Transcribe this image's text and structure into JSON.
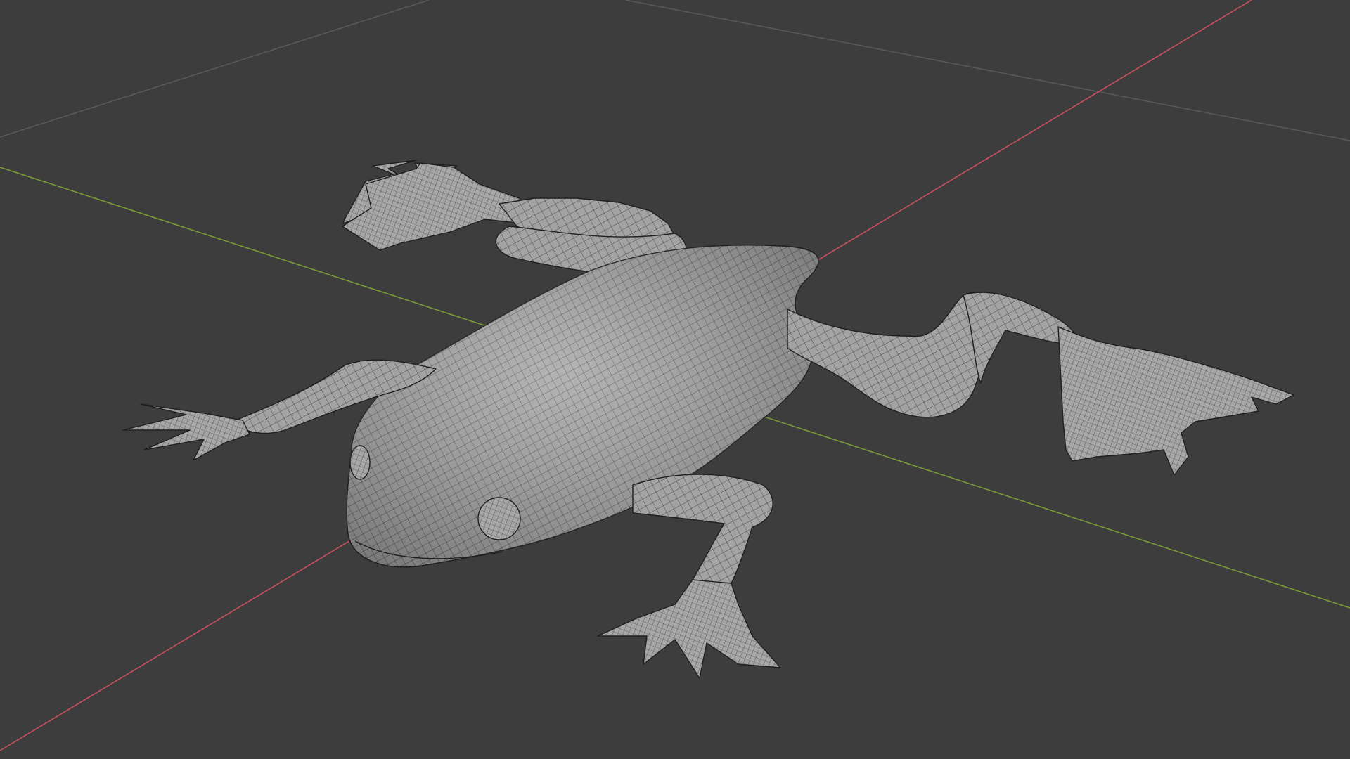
{
  "viewport": {
    "background": "#3d3d3d",
    "grid_line_color": "#5a5a5a",
    "x_axis_color": "#c9505f",
    "y_axis_color": "#7a9a37"
  },
  "model": {
    "name": "frog",
    "shading": "solid",
    "overlay": "wireframe",
    "surface_color": "#9d9d9d",
    "wire_color": "#1a1a1a"
  }
}
